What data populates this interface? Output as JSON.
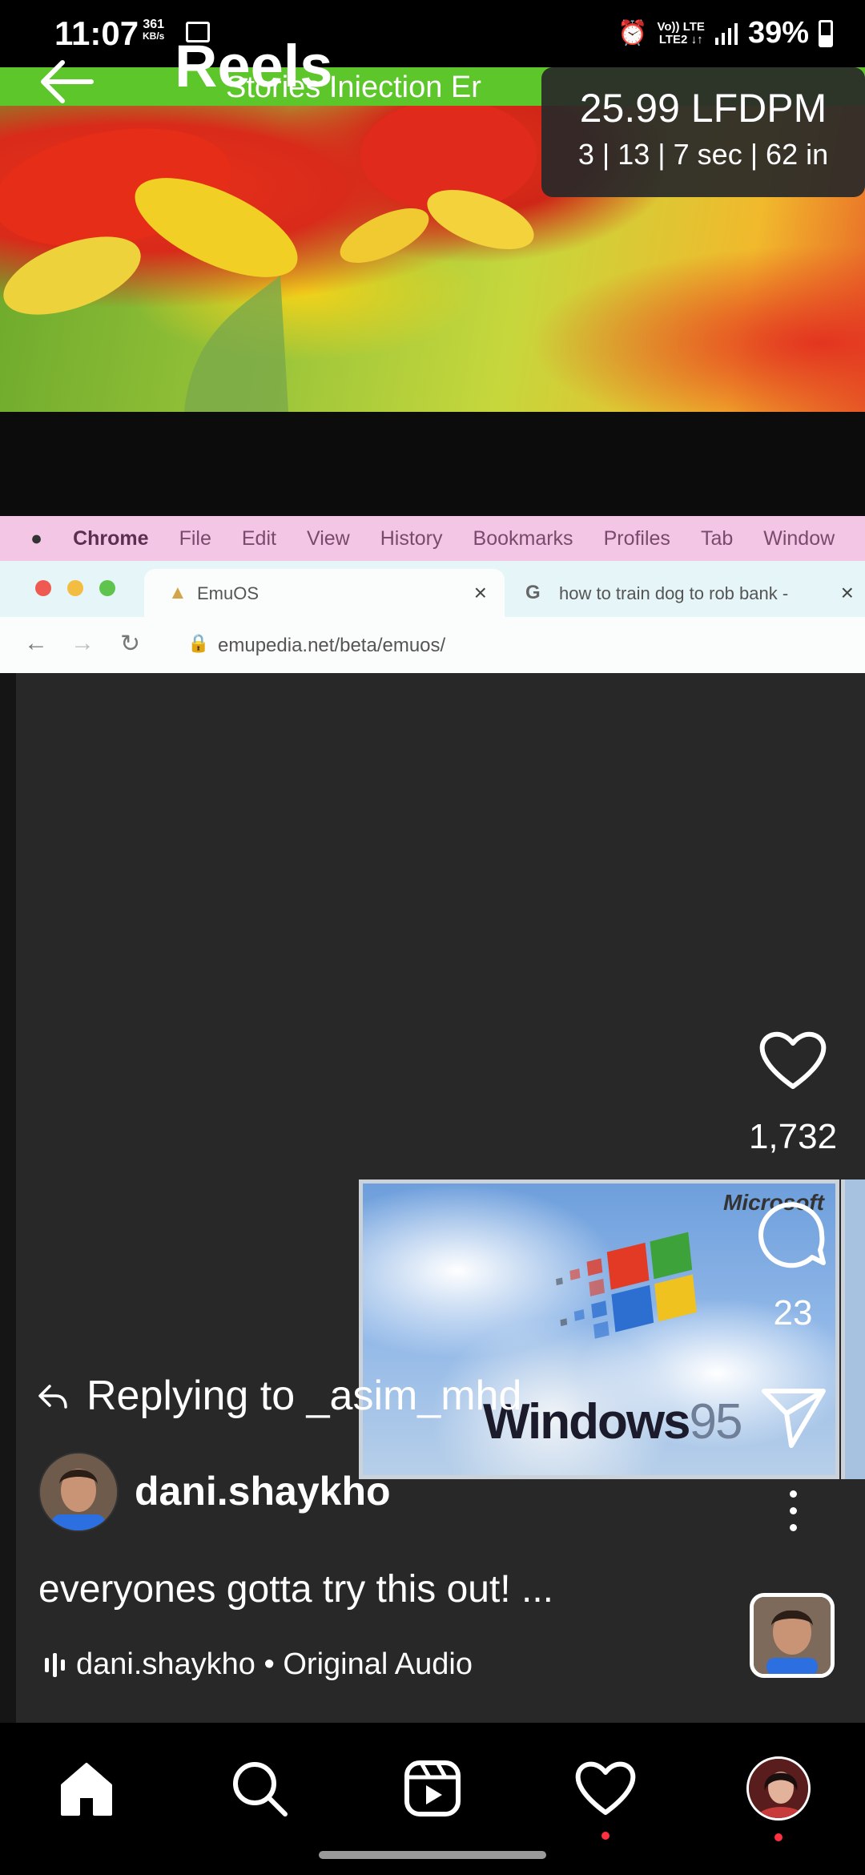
{
  "status_bar": {
    "time": "11:07",
    "speed_value": "361",
    "speed_unit": "KB/s",
    "net_line1": "Vo)) LTE",
    "net_line2": "LTE2 ↓↑",
    "battery": "39%"
  },
  "overlay": {
    "injection_text": "Stories Iniection Er",
    "lfdpm_main": "25.99 LFDPM",
    "lfdpm_sub": "3 | 13 | 7 sec | 62 in"
  },
  "header": {
    "title": "Reels"
  },
  "video_content": {
    "menubar": [
      "Chrome",
      "File",
      "Edit",
      "View",
      "History",
      "Bookmarks",
      "Profiles",
      "Tab",
      "Window"
    ],
    "tab1": "EmuOS",
    "tab2": "how to train dog to rob bank -",
    "url": "emupedia.net/beta/emuos/",
    "win_brand": "Microsoft",
    "win_text": "Windows",
    "win_version": "95"
  },
  "reel": {
    "reply_text": "Replying to _asim_mhd",
    "author": "dani.shaykho",
    "caption": "everyones gotta try this out! ...",
    "audio": "dani.shaykho • Original Audio",
    "like_count": "1,732",
    "comment_count": "23"
  },
  "icons": {
    "back": "arrow-left-icon",
    "like": "heart-icon",
    "comment": "comment-bubble-icon",
    "share": "paper-plane-icon",
    "more": "more-vertical-icon"
  },
  "bottom_nav": [
    "home",
    "search",
    "reels",
    "activity",
    "profile"
  ],
  "colors": {
    "notif_dot": "#ff3040",
    "injection_band": "#5cc62a",
    "mac_menubar": "#f4c6e6"
  }
}
